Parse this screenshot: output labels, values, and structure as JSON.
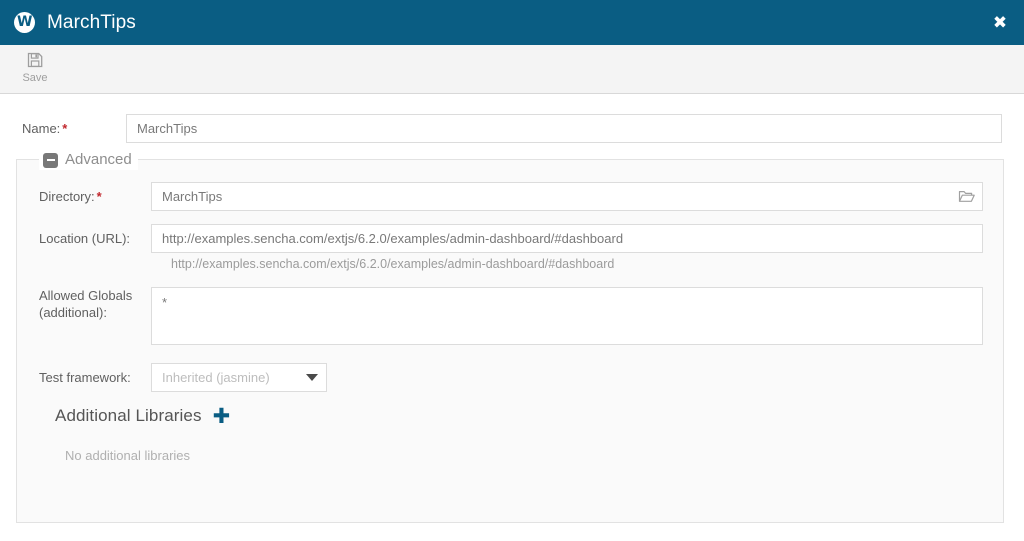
{
  "window": {
    "app_badge": "W",
    "title": "MarchTips",
    "close_label": "✖",
    "accent_color": "#0a5d83",
    "required_color": "#c1272d"
  },
  "toolbar": {
    "buttons": [
      {
        "label": "Save",
        "icon": "floppy-disk-icon"
      }
    ]
  },
  "form": {
    "name": {
      "label": "Name:",
      "required_marker": "*",
      "value": "MarchTips",
      "placeholder": ""
    }
  },
  "advanced": {
    "legend": "Advanced",
    "collapsed": false,
    "directory": {
      "label": "Directory:",
      "required_marker": "*",
      "value": "MarchTips",
      "placeholder": "",
      "browse_icon": "folder-open-icon"
    },
    "location": {
      "label": "Location (URL):",
      "value": "http://examples.sencha.com/extjs/6.2.0/examples/admin-dashboard/#dashboard",
      "placeholder": "",
      "hint": "http://examples.sencha.com/extjs/6.2.0/examples/admin-dashboard/#dashboard"
    },
    "allowed_globals": {
      "label_line1": "Allowed Globals",
      "label_line2": "(additional):",
      "value": "*",
      "placeholder": ""
    },
    "test_framework": {
      "label": "Test framework:",
      "selected": "Inherited (jasmine)",
      "is_placeholder": true,
      "options": [
        "Inherited (jasmine)"
      ]
    },
    "additional_libraries": {
      "title": "Additional Libraries",
      "add_label": "✚",
      "empty_text": "No additional libraries"
    }
  }
}
